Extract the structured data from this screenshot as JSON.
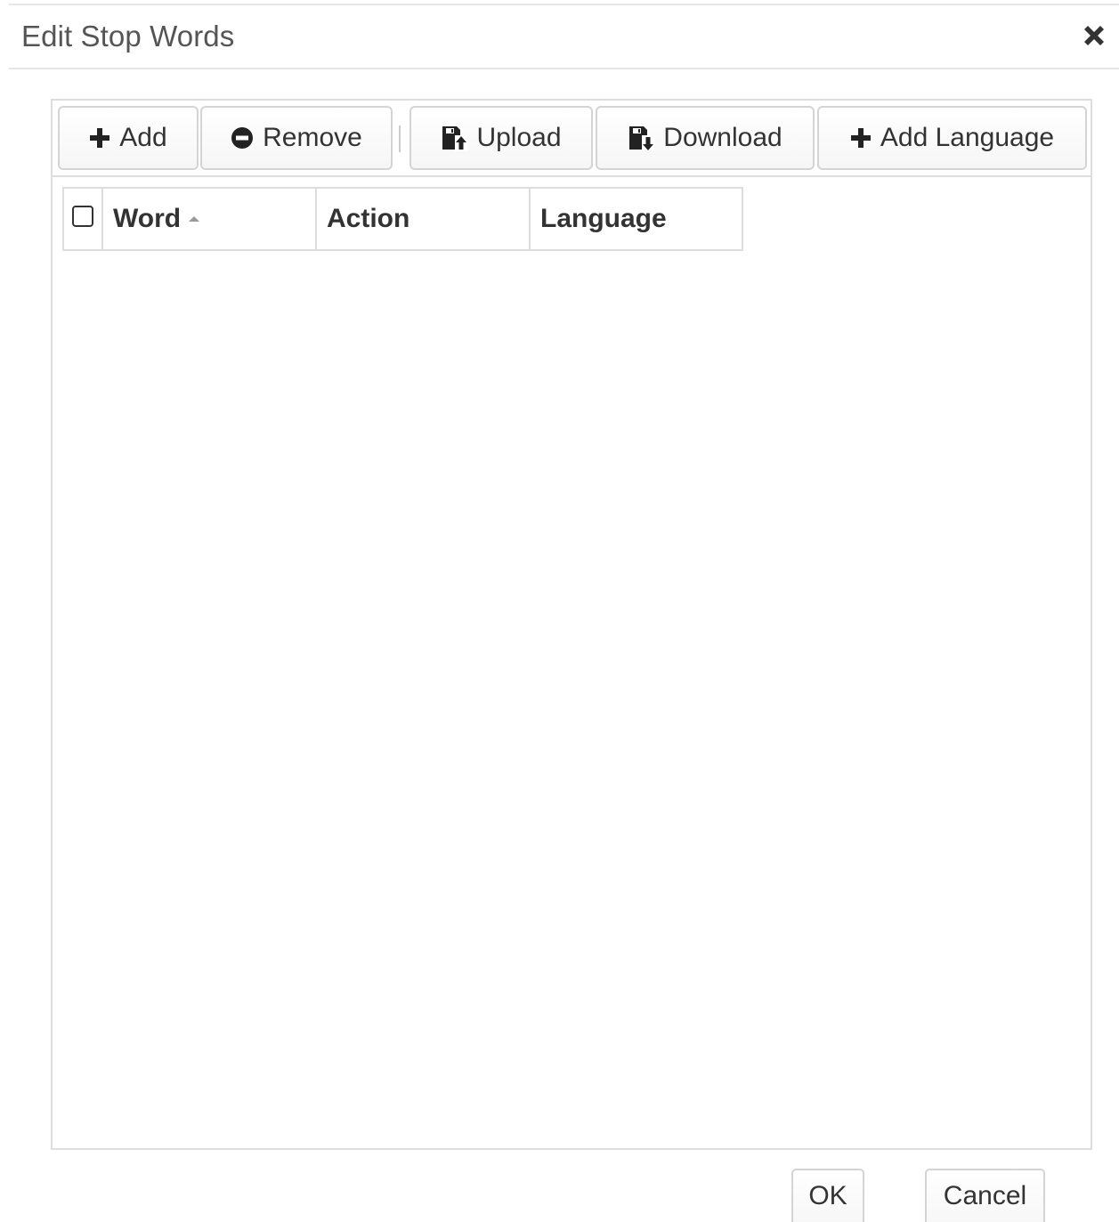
{
  "dialog": {
    "title": "Edit Stop Words"
  },
  "toolbar": {
    "add_label": "Add",
    "remove_label": "Remove",
    "upload_label": "Upload",
    "download_label": "Download",
    "add_language_label": "Add Language"
  },
  "grid": {
    "columns": [
      {
        "label": "Word",
        "sort": "ascending"
      },
      {
        "label": "Action"
      },
      {
        "label": "Language"
      }
    ],
    "rows": []
  },
  "footer": {
    "ok_label": "OK",
    "cancel_label": "Cancel"
  },
  "icons": {
    "add": "plus-icon",
    "remove": "minus-circle-icon",
    "upload": "floppy-upload-icon",
    "download": "floppy-download-icon",
    "add_language": "plus-icon",
    "close": "close-icon",
    "sort": "sort-ascending-icon"
  },
  "colors": {
    "border": "#dddddd",
    "text": "#333333",
    "title": "#555555"
  }
}
